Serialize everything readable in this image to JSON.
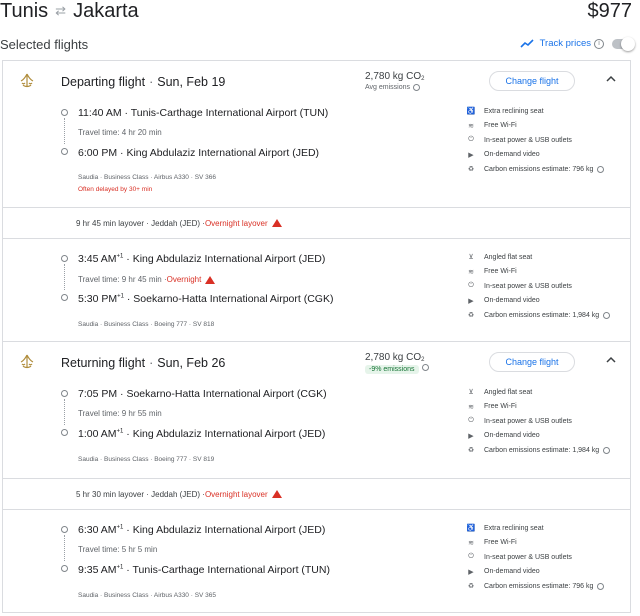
{
  "header": {
    "from": "Tunis",
    "to": "Jakarta",
    "price": "$977"
  },
  "selected": {
    "title": "Selected flights",
    "track_label": "Track prices"
  },
  "icons": {
    "swap": "swap-arrows-icon",
    "trend": "trend-line-icon",
    "logo": "saudia-logo-icon"
  },
  "colors": {
    "accent": "#1a73e8",
    "warn": "#d93025",
    "eco": "#137333"
  },
  "departing": {
    "title": "Departing flight",
    "date": "Sun, Feb 19",
    "co2": "2,780 kg CO",
    "co2_sub": "2",
    "co2_note": "Avg emissions",
    "change_label": "Change flight",
    "leg1": {
      "dep_time": "11:40 AM",
      "dep_airport": "Tunis-Carthage International Airport (TUN)",
      "travel": "Travel time: 4 hr 20 min",
      "arr_time": "6:00 PM",
      "arr_airport": "King Abdulaziz International Airport (JED)",
      "meta": "Saudia · Business Class · Airbus A330 · SV 366",
      "delay": "Often delayed by 30+ min",
      "amenities": [
        "Extra reclining seat",
        "Free Wi-Fi",
        "In-seat power & USB outlets",
        "On-demand video",
        "Carbon emissions estimate: 796 kg"
      ]
    },
    "layover": "9 hr 45 min layover · Jeddah (JED) · ",
    "layover_warn": "Overnight layover",
    "leg2": {
      "dep_time": "3:45 AM",
      "dep_sup": "+1",
      "dep_airport": "King Abdulaziz International Airport (JED)",
      "travel": "Travel time: 9 hr 45 min · ",
      "travel_warn": "Overnight",
      "arr_time": "5:30 PM",
      "arr_sup": "+1",
      "arr_airport": "Soekarno-Hatta International Airport (CGK)",
      "meta": "Saudia · Business Class · Boeing 777 · SV 818",
      "amenities": [
        "Angled flat seat",
        "Free Wi-Fi",
        "In-seat power & USB outlets",
        "On-demand video",
        "Carbon emissions estimate: 1,984 kg"
      ]
    }
  },
  "returning": {
    "title": "Returning flight",
    "date": "Sun, Feb 26",
    "co2": "2,780 kg CO",
    "co2_sub": "2",
    "co2_badge": "-9% emissions",
    "change_label": "Change flight",
    "leg1": {
      "dep_time": "7:05 PM",
      "dep_airport": "Soekarno-Hatta International Airport (CGK)",
      "travel": "Travel time: 9 hr 55 min",
      "arr_time": "1:00 AM",
      "arr_sup": "+1",
      "arr_airport": "King Abdulaziz International Airport (JED)",
      "meta": "Saudia · Business Class · Boeing 777 · SV 819",
      "amenities": [
        "Angled flat seat",
        "Free Wi-Fi",
        "In-seat power & USB outlets",
        "On-demand video",
        "Carbon emissions estimate: 1,984 kg"
      ]
    },
    "layover": "5 hr 30 min layover · Jeddah (JED) · ",
    "layover_warn": "Overnight layover",
    "leg2": {
      "dep_time": "6:30 AM",
      "dep_sup": "+1",
      "dep_airport": "King Abdulaziz International Airport (JED)",
      "travel": "Travel time: 5 hr 5 min",
      "arr_time": "9:35 AM",
      "arr_sup": "+1",
      "arr_airport": "Tunis-Carthage International Airport (TUN)",
      "meta": "Saudia · Business Class · Airbus A330 · SV 365",
      "amenities": [
        "Extra reclining seat",
        "Free Wi-Fi",
        "In-seat power & USB outlets",
        "On-demand video",
        "Carbon emissions estimate: 796 kg"
      ]
    }
  }
}
